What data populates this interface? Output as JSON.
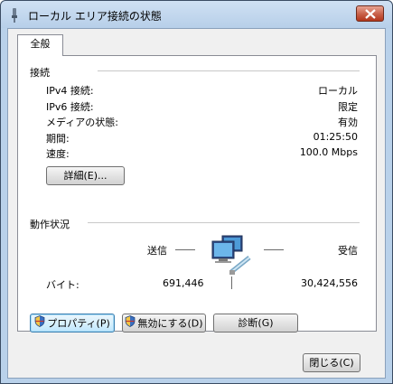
{
  "window": {
    "title": "ローカル エリア接続の状態"
  },
  "tab": {
    "label": "全般"
  },
  "connection": {
    "group_label": "接続",
    "rows": [
      {
        "label": "IPv4 接続:",
        "value": "ローカル"
      },
      {
        "label": "IPv6 接続:",
        "value": "限定"
      },
      {
        "label": "メディアの状態:",
        "value": "有効"
      },
      {
        "label": "期間:",
        "value": "01:25:50"
      },
      {
        "label": "速度:",
        "value": "100.0 Mbps"
      }
    ],
    "details_button": "詳細(E)..."
  },
  "activity": {
    "group_label": "動作状況",
    "sent_label": "送信",
    "received_label": "受信",
    "bytes_label": "バイト:",
    "bytes_sent": "691,446",
    "bytes_received": "30,424,556"
  },
  "buttons": {
    "properties": "プロパティ(P)",
    "disable": "無効にする(D)",
    "diagnose": "診断(G)",
    "close": "閉じる(C)"
  },
  "icons": {
    "title": "network-plug-icon",
    "network": "network-computers-icon",
    "shield": "uac-shield-icon",
    "close": "close-icon"
  }
}
